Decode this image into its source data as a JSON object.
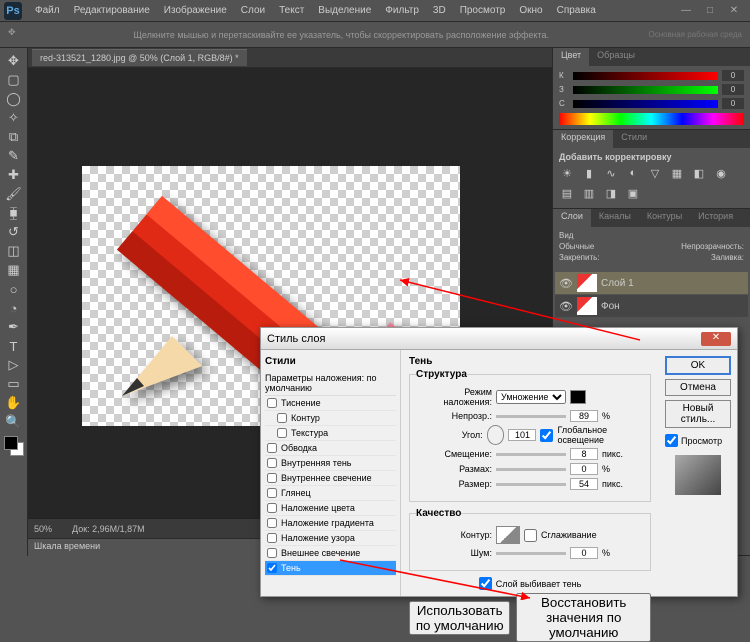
{
  "app": {
    "logo": "Ps"
  },
  "menu": [
    "Файл",
    "Редактирование",
    "Изображение",
    "Слои",
    "Текст",
    "Выделение",
    "Фильтр",
    "3D",
    "Просмотр",
    "Окно",
    "Справка"
  ],
  "optbar": {
    "hint": "Щелкните мышью и перетаскивайте ее указатель, чтобы скорректировать расположение эффекта.",
    "workspace": "Основная рабочая среда"
  },
  "tab": {
    "title": "red-313521_1280.jpg @ 50% (Слой 1, RGB/8#) *"
  },
  "zoom": {
    "pct": "50%",
    "doc": "Док: 2,96M/1,87M"
  },
  "timeline": {
    "title": "Шкала времени"
  },
  "color_panel": {
    "tabs": [
      "Цвет",
      "Образцы"
    ],
    "channels": [
      {
        "label": "К",
        "val": "0"
      },
      {
        "label": "З",
        "val": "0"
      },
      {
        "label": "С",
        "val": "0"
      }
    ]
  },
  "adjust_panel": {
    "tabs": [
      "Коррекция",
      "Стили"
    ],
    "add_label": "Добавить корректировку"
  },
  "layers_panel": {
    "tabs": [
      "Слои",
      "Каналы",
      "Контуры",
      "История"
    ],
    "kind": "Вид",
    "blend": "Обычные",
    "opacity_label": "Непрозрачность:",
    "lock_label": "Закрепить:",
    "fill_label": "Заливка:",
    "layers": [
      {
        "name": "Слой 1",
        "active": true
      },
      {
        "name": "Фон",
        "active": false
      }
    ]
  },
  "dialog": {
    "title": "Стиль слоя",
    "styles_hdr": "Стили",
    "params_hdr": "Параметры наложения: по умолчанию",
    "style_list": [
      {
        "label": "Тиснение",
        "checked": false
      },
      {
        "label": "Контур",
        "checked": false
      },
      {
        "label": "Текстура",
        "checked": false
      },
      {
        "label": "Обводка",
        "checked": false
      },
      {
        "label": "Внутренняя тень",
        "checked": false
      },
      {
        "label": "Внутреннее свечение",
        "checked": false
      },
      {
        "label": "Глянец",
        "checked": false
      },
      {
        "label": "Наложение цвета",
        "checked": false
      },
      {
        "label": "Наложение градиента",
        "checked": false
      },
      {
        "label": "Наложение узора",
        "checked": false
      },
      {
        "label": "Внешнее свечение",
        "checked": false
      },
      {
        "label": "Тень",
        "checked": true
      }
    ],
    "section_title": "Тень",
    "structure_title": "Структура",
    "blend_mode_label": "Режим наложения:",
    "blend_mode_value": "Умножение",
    "opacity_label": "Непрозр.:",
    "opacity_value": "89",
    "pct": "%",
    "angle_label": "Угол:",
    "angle_value": "101",
    "global_light": "Глобальное освещение",
    "distance_label": "Смещение:",
    "distance_value": "8",
    "px": "пикс.",
    "spread_label": "Размах:",
    "spread_value": "0",
    "size_label": "Размер:",
    "size_value": "54",
    "quality_title": "Качество",
    "contour_label": "Контур:",
    "antialias": "Сглаживание",
    "noise_label": "Шум:",
    "noise_value": "0",
    "knockout": "Слой выбивает тень",
    "make_default": "Использовать по умолчанию",
    "reset_default": "Восстановить значения по умолчанию",
    "ok": "OK",
    "cancel": "Отмена",
    "new_style": "Новый стиль...",
    "preview": "Просмотр"
  }
}
